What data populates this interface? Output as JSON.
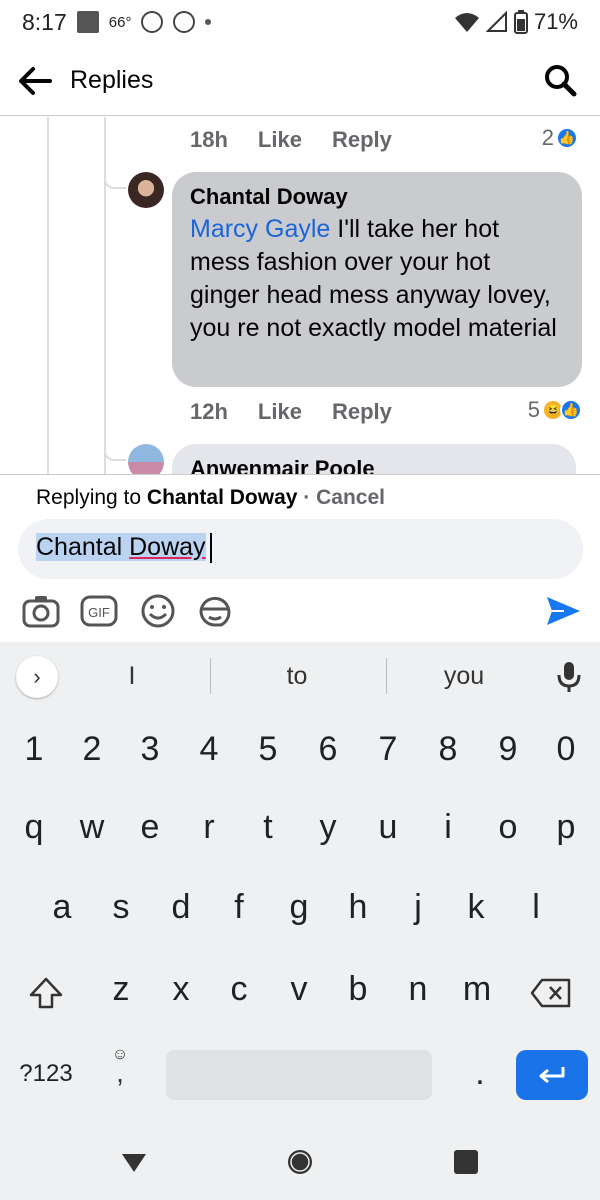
{
  "status_bar": {
    "time": "8:17",
    "temperature": "66°",
    "battery": "71%"
  },
  "header": {
    "title": "Replies"
  },
  "thread": {
    "prev_meta": {
      "time": "18h",
      "like_label": "Like",
      "reply_label": "Reply",
      "reaction_count": "2"
    },
    "comment": {
      "author": "Chantal Doway",
      "mention": "Marcy Gayle",
      "text": " I'll take her hot mess fashion over your hot ginger head mess anyway lovey,  you re not exactly model material",
      "time": "12h",
      "like_label": "Like",
      "reply_label": "Reply",
      "reaction_count": "5"
    },
    "next_comment": {
      "author": "Anwenmair Poole"
    }
  },
  "composer": {
    "replying_prefix": "Replying to ",
    "replying_name": "Chantal Doway",
    "separator": " · ",
    "cancel_label": "Cancel",
    "input_first": "Chantal ",
    "input_second": "Doway",
    "gif_label": "GIF"
  },
  "keyboard": {
    "suggestions": [
      "I",
      "to",
      "you"
    ],
    "row_numbers": [
      "1",
      "2",
      "3",
      "4",
      "5",
      "6",
      "7",
      "8",
      "9",
      "0"
    ],
    "row_1": [
      "q",
      "w",
      "e",
      "r",
      "t",
      "y",
      "u",
      "i",
      "o",
      "p"
    ],
    "row_2": [
      "a",
      "s",
      "d",
      "f",
      "g",
      "h",
      "j",
      "k",
      "l"
    ],
    "row_3": [
      "z",
      "x",
      "c",
      "v",
      "b",
      "n",
      "m"
    ],
    "symbols_key": "?123",
    "comma_key": ",",
    "period_key": "."
  },
  "colors": {
    "accent": "#1877f2",
    "mention": "#1b63d8",
    "bubble": "#c9cbcf",
    "enter_key": "#1a73e8"
  }
}
